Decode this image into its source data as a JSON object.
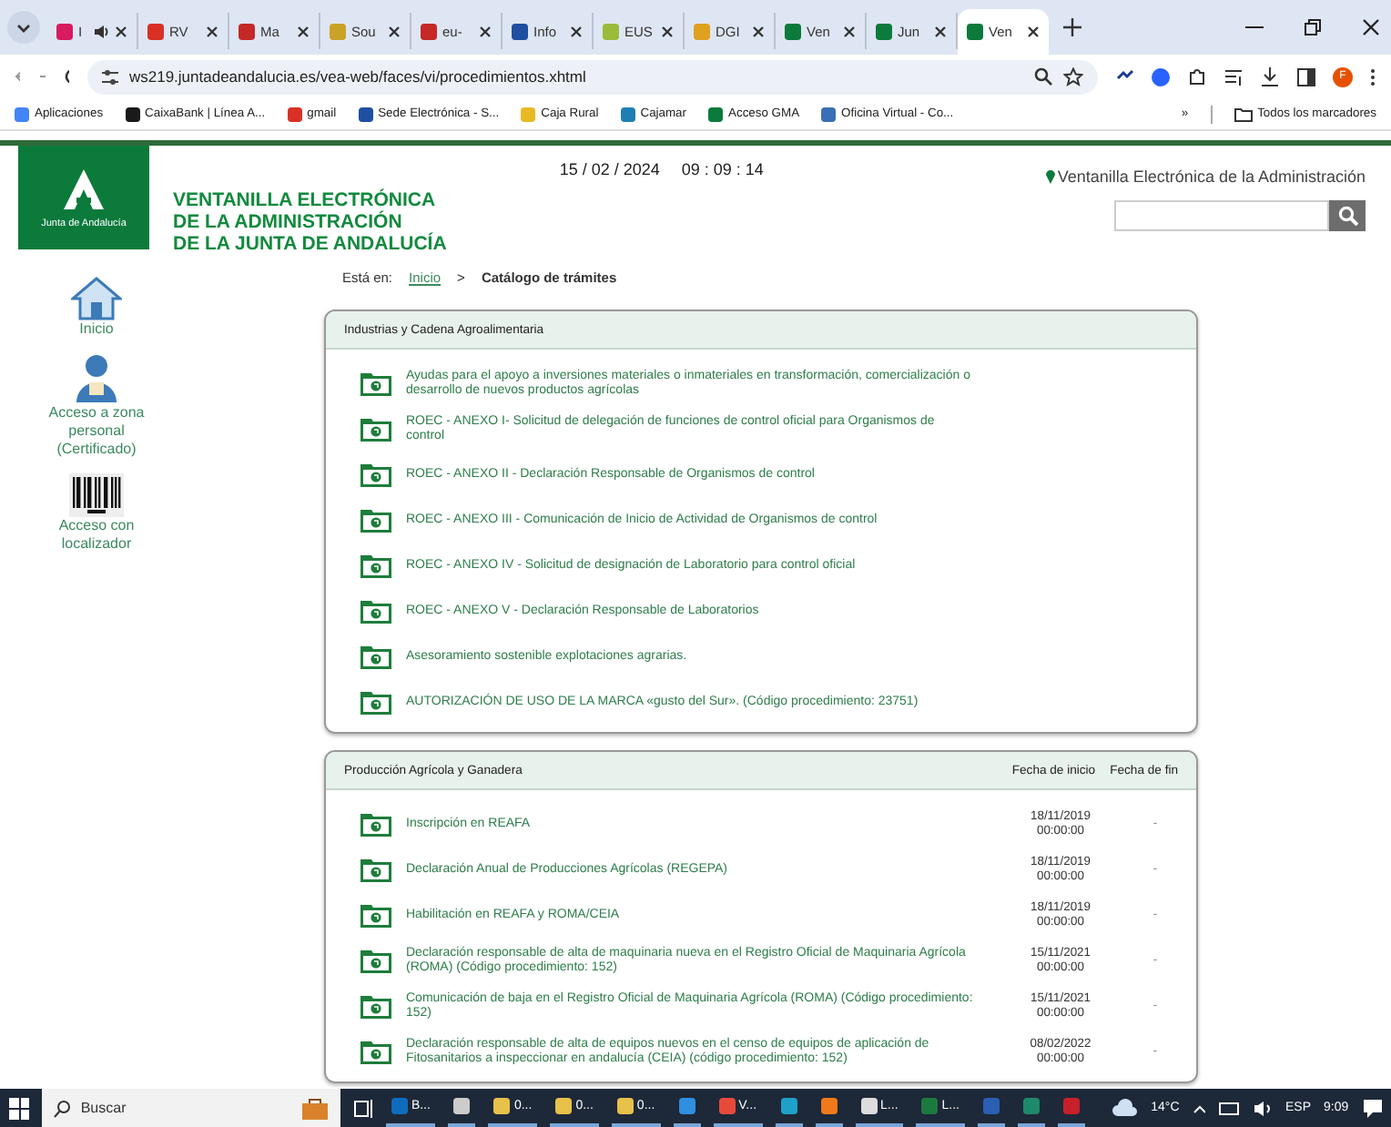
{
  "browser": {
    "tabs": [
      {
        "label": "I",
        "color": "#d81b60",
        "selected": false,
        "audio": true
      },
      {
        "label": "RV",
        "color": "#d93025",
        "selected": false,
        "audio": false
      },
      {
        "label": "Ma",
        "color": "#c62828",
        "selected": false,
        "audio": false
      },
      {
        "label": "Sou",
        "color": "#c9a227",
        "selected": false,
        "audio": false
      },
      {
        "label": "eu-",
        "color": "#c62828",
        "selected": false,
        "audio": false
      },
      {
        "label": "Info",
        "color": "#1e4fa0",
        "selected": false,
        "audio": false
      },
      {
        "label": "EUS",
        "color": "#9bbb3b",
        "selected": false,
        "audio": false
      },
      {
        "label": "DGI",
        "color": "#e0a020",
        "selected": false,
        "audio": false
      },
      {
        "label": "Ven",
        "color": "#0b7a3b",
        "selected": false,
        "audio": false
      },
      {
        "label": "Jun",
        "color": "#0b7a3b",
        "selected": false,
        "audio": false
      },
      {
        "label": "Ven",
        "color": "#0b7a3b",
        "selected": true,
        "audio": false
      }
    ],
    "url": "ws219.juntadeandalucia.es/vea-web/faces/vi/procedimientos.xhtml",
    "profile": "F",
    "bookmarks": [
      {
        "label": "Aplicaciones",
        "color": "#4285f4"
      },
      {
        "label": "CaixaBank | Línea A...",
        "color": "#1a1a1a"
      },
      {
        "label": "gmail",
        "color": "#d93025"
      },
      {
        "label": "Sede Electrónica - S...",
        "color": "#1e4fa0"
      },
      {
        "label": "Caja Rural",
        "color": "#e8b923"
      },
      {
        "label": "Cajamar",
        "color": "#1f7fb5"
      },
      {
        "label": "Acceso GMA",
        "color": "#0b7a3b"
      },
      {
        "label": "Oficina Virtual - Co...",
        "color": "#3b6fb5"
      }
    ],
    "more": "»",
    "all_bookmarks": "Todos los marcadores"
  },
  "page": {
    "logo_text": "Junta de Andalucía",
    "title_lines": [
      "VENTANILLA ELECTRÓNICA",
      "DE LA ADMINISTRACIÓN",
      "DE LA JUNTA DE ANDALUCÍA"
    ],
    "date": "15 / 02 / 2024",
    "time": "09 : 09 : 14",
    "portal_label": "Ventanilla Electrónica de la Administración",
    "breadcrumb": {
      "prefix": "Está en:",
      "link": "Inicio",
      "separator": ">",
      "current": "Catálogo de trámites"
    },
    "sidebar": [
      {
        "kind": "home",
        "label": "Inicio"
      },
      {
        "kind": "person",
        "label": "Acceso a zona personal (Certificado)"
      },
      {
        "kind": "barcode",
        "label": "Acceso con localizador"
      }
    ],
    "panels": [
      {
        "title": "Industrias y Cadena Agroalimentaria",
        "items": [
          {
            "text": "Ayudas para el apoyo a inversiones materiales o inmateriales en transformación, comercialización o desarrollo de nuevos productos agrícolas"
          },
          {
            "text": "ROEC - ANEXO I- Solicitud de delegación de funciones de control oficial para Organismos de control"
          },
          {
            "text": "ROEC - ANEXO II - Declaración Responsable de Organismos de control"
          },
          {
            "text": "ROEC - ANEXO III - Comunicación de Inicio de Actividad de Organismos de control"
          },
          {
            "text": "ROEC - ANEXO IV - Solicitud de designación de Laboratorio para control oficial"
          },
          {
            "text": "ROEC - ANEXO V - Declaración Responsable de Laboratorios"
          },
          {
            "text": "Asesoramiento sostenible explotaciones agrarias."
          },
          {
            "text": "AUTORIZACIÓN DE USO DE LA MARCA «gusto del Sur». (Código procedimiento: 23751)"
          }
        ]
      },
      {
        "title": "Producción Agrícola y Ganadera",
        "columns": [
          "Fecha de inicio",
          "Fecha de fin"
        ],
        "items": [
          {
            "text": "Inscripción en REAFA",
            "start": "18/11/2019 00:00:00",
            "end": "-"
          },
          {
            "text": "Declaración Anual de Producciones Agrícolas (REGEPA)",
            "start": "18/11/2019 00:00:00",
            "end": "-"
          },
          {
            "text": "Habilitación en REAFA y ROMA/CEIA",
            "start": "18/11/2019 00:00:00",
            "end": "-"
          },
          {
            "text": "Declaración responsable de alta de maquinaria nueva en el Registro Oficial de Maquinaria Agrícola (ROMA) (Código procedimiento: 152)",
            "start": "15/11/2021 00:00:00",
            "end": "-"
          },
          {
            "text": "Comunicación de baja en el Registro Oficial de Maquinaria Agrícola (ROMA) (Código procedimiento: 152)",
            "start": "15/11/2021 00:00:00",
            "end": "-"
          },
          {
            "text": "Declaración responsable de alta de equipos nuevos en el censo de equipos de aplicación de Fitosanitarios a inspeccionar en andalucía (CEIA) (código procedimiento: 152)",
            "start": "08/02/2022 00:00:00",
            "end": "-"
          }
        ]
      }
    ]
  },
  "taskbar": {
    "search": "Buscar",
    "apps": [
      {
        "label": "B...",
        "color": "#0f6cbd"
      },
      {
        "color": "#cccccc"
      },
      {
        "label": "0...",
        "color": "#e8c14a"
      },
      {
        "label": "0...",
        "color": "#e8c14a"
      },
      {
        "label": "0...",
        "color": "#e8c14a"
      },
      {
        "color": "#2f8fe0"
      },
      {
        "label": "V...",
        "color": "#e84a3a"
      },
      {
        "color": "#1fa0c8"
      },
      {
        "color": "#f07a1a"
      },
      {
        "label": "L...",
        "color": "#dddddd"
      },
      {
        "label": "L...",
        "color": "#1d7a3f"
      },
      {
        "color": "#2b5fb3"
      },
      {
        "color": "#1e8a6a"
      },
      {
        "color": "#c8202a"
      }
    ],
    "weather": "14°C",
    "lang": "ESP",
    "clock": "9:09"
  }
}
